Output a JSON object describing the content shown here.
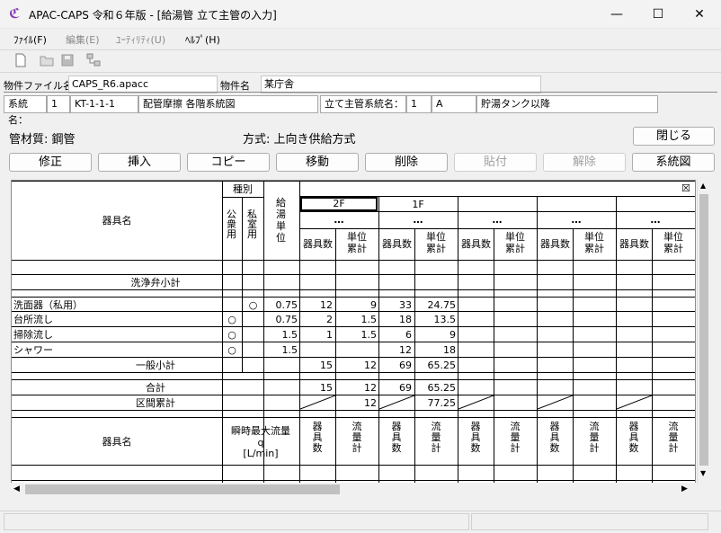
{
  "window": {
    "title": "APAC-CAPS 令和６年版 - [給湯管 立て主管の入力]",
    "app_icon": "caps-logo-icon",
    "minimize": "—",
    "maximize": "☐",
    "close": "✕"
  },
  "menu": [
    "ﾌｧｲﾙ(F)",
    "編集(E)",
    "ﾕｰﾃｨﾘﾃｨ(U)",
    "ﾍﾙﾌﾟ(H)"
  ],
  "toolbar": {
    "icons": [
      "new-file-icon",
      "open-folder-icon",
      "save-icon",
      "network-icon"
    ]
  },
  "property": {
    "file_label": "物件ファイル名",
    "file_value": "CAPS_R6.apacc",
    "name_label": "物件名",
    "name_value": "某庁舎"
  },
  "system": {
    "label": "系統名：",
    "num": "1",
    "code": "KT-1-1-1",
    "desc": "配管摩擦 各階系統図",
    "main_label": "立て主管系統名：",
    "main_num": "1",
    "main_code": "A",
    "main_desc": "貯湯タンク以降"
  },
  "info": {
    "material": "管材質: 鋼管",
    "method": "方式: 上向き供給方式"
  },
  "buttons": {
    "close": "閉じる",
    "edit": "修正",
    "insert": "挿入",
    "copy": "コピー",
    "move": "移動",
    "delete": "削除",
    "paste": "貼付",
    "release": "解除",
    "diagram": "系統図"
  },
  "table": {
    "h_name": "器具名",
    "h_kind": "種別",
    "h_public": "公衆用",
    "h_private": "私室用",
    "h_unit": "給湯単位",
    "floors": [
      "2F",
      "1F",
      "",
      "",
      ""
    ],
    "floor_dots": [
      "…",
      "…",
      "…",
      "…",
      "…"
    ],
    "h_count": "器具数",
    "h_cum": "単位累計",
    "corner": "☒",
    "washer_subtotal": "洗浄弁小計",
    "rows": [
      {
        "name": "洗面器（私用）",
        "pub": "",
        "priv": "○",
        "unit": "0.75",
        "c2": "12",
        "u2": "9",
        "c1": "33",
        "u1": "24.75"
      },
      {
        "name": "台所流し",
        "pub": "○",
        "priv": "",
        "unit": "0.75",
        "c2": "2",
        "u2": "1.5",
        "c1": "18",
        "u1": "13.5"
      },
      {
        "name": "掃除流し",
        "pub": "○",
        "priv": "",
        "unit": "1.5",
        "c2": "1",
        "u2": "1.5",
        "c1": "6",
        "u1": "9"
      },
      {
        "name": "シャワー",
        "pub": "○",
        "priv": "",
        "unit": "1.5",
        "c2": "",
        "u2": "",
        "c1": "12",
        "u1": "18"
      }
    ],
    "general": {
      "label": "一般小計",
      "c2": "15",
      "u2": "12",
      "c1": "69",
      "u1": "65.25"
    },
    "total": {
      "label": "合計",
      "c2": "15",
      "u2": "12",
      "c1": "69",
      "u1": "65.25"
    },
    "section": {
      "label": "区間累計",
      "u2": "12",
      "u1": "77.25"
    },
    "h_name2": "器具名",
    "h_flow": "瞬時最大流量",
    "h_q": "q",
    "h_lmin": "[L/min]",
    "h_count2": "器具数",
    "h_flowsum": "流量計"
  }
}
